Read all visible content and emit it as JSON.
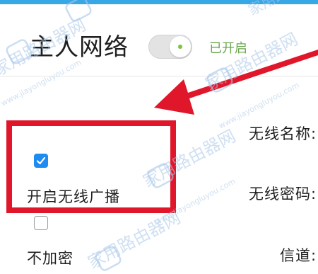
{
  "header": {
    "title": "主人网络",
    "toggle_state": "on",
    "toggle_status": "已开启"
  },
  "options": [
    {
      "label": "开启无线广播",
      "checked": true
    },
    {
      "label": "不加密",
      "checked": false
    }
  ],
  "fields": {
    "ssid_label": "无线名称:",
    "password_label": "无线密码:",
    "channel_label": "信道:"
  },
  "watermark": {
    "cn": "家用路由器网",
    "url": "www.jiayongluyou.com"
  },
  "colors": {
    "accent_top": "#38a7e6",
    "status_green": "#6aa84f",
    "checkbox_blue": "#1f8bf0",
    "highlight_red": "#e0172a"
  }
}
